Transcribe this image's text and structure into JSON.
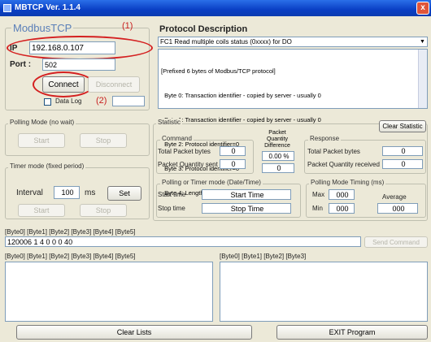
{
  "window": {
    "title": "MBTCP  Ver. 1.1.4",
    "close_label": "x"
  },
  "annotations": {
    "one": "(1)",
    "two": "(2)"
  },
  "modbus": {
    "title": "ModbusTCP",
    "ip_label": "IP",
    "ip_value": "192.168.0.107",
    "port_label": "Port :",
    "port_value": "502",
    "connect_label": "Connect",
    "disconnect_label": "Disconnect",
    "datalog_label": "Data Log"
  },
  "protocol": {
    "title": "Protocol Description",
    "selected": "FC1  Read multiple coils status (0xxxx)  for DO",
    "lines": [
      "[Prefixed 6 bytes of Modbus/TCP protocol]",
      "  Byte 0: Transaction identifier - copied by server - usually 0",
      "  Byte 1: Transaction identifier - copied by server - usually 0",
      "  Byte 2: Protocol identifier=0",
      "  Byte 3: Protocol identifier=0",
      "  Byte 4: Length field (upper byte)=0"
    ]
  },
  "polling": {
    "title": "Polling Mode (no wait)",
    "start": "Start",
    "stop": "Stop"
  },
  "timer": {
    "title": "Timer mode (fixed period)",
    "interval_label": "Interval",
    "interval_value": "100",
    "unit": "ms",
    "set": "Set",
    "start": "Start",
    "stop": "Stop"
  },
  "statistic": {
    "title": "Statistic",
    "clear": "Clear Statistic",
    "command_title": "Command",
    "total_bytes_label": "Total Packet bytes",
    "total_bytes_value": "0",
    "packet_sent_label": "Packet Quantity sent",
    "packet_sent_value": "0",
    "diff_label": "Packet Quantity Difference",
    "diff_percent": "0.00 %",
    "diff_value": "0",
    "response_title": "Response",
    "resp_bytes_label": "Total Packet bytes",
    "resp_bytes_value": "0",
    "resp_received_label": "Packet Quantity received",
    "resp_received_value": "0",
    "time_title": "Polling or Timer mode (Date/Time)",
    "start_time_label": "Start time",
    "start_time_value": "Start Time",
    "stop_time_label": "Stop time",
    "stop_time_value": "Stop Time",
    "timing_title": "Polling Mode Timing (ms)",
    "max_label": "Max",
    "max_value": "000",
    "min_label": "Min",
    "min_value": "000",
    "avg_label": "Average",
    "avg_value": "000"
  },
  "command": {
    "header": "[Byte0]  [Byte1]  [Byte2]  [Byte3]  [Byte4]  [Byte5]",
    "value": "120006  1 4 0 0 0 40",
    "send": "Send Command"
  },
  "lists": {
    "left_header": "[Byte0]  [Byte1]  [Byte2]  [Byte3]  [Byte4]  [Byte5]",
    "right_header": "[Byte0]  [Byte1]  [Byte2]  [Byte3]"
  },
  "footer": {
    "clear_lists": "Clear Lists",
    "exit": "EXIT Program"
  }
}
